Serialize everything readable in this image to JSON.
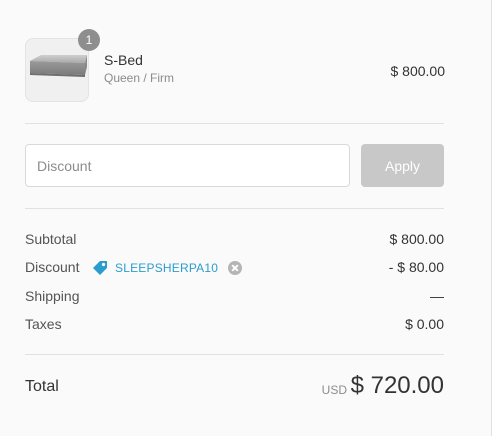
{
  "product": {
    "quantity": "1",
    "title": "S-Bed",
    "variant": "Queen / Firm",
    "price": "$ 800.00",
    "image_icon": "mattress-image"
  },
  "discount": {
    "placeholder": "Discount",
    "apply_label": "Apply"
  },
  "summary": {
    "subtotal_label": "Subtotal",
    "subtotal_value": "$ 800.00",
    "discount_label": "Discount",
    "discount_code": "SLEEPSHERPA10",
    "discount_value": "- $ 80.00",
    "shipping_label": "Shipping",
    "shipping_value": "—",
    "taxes_label": "Taxes",
    "taxes_value": "$ 0.00"
  },
  "total": {
    "label": "Total",
    "currency": "USD",
    "value": "$ 720.00"
  },
  "colors": {
    "accent": "#2a9dcc",
    "button_disabled": "#c8c8c8",
    "badge": "#8e8e8e"
  }
}
